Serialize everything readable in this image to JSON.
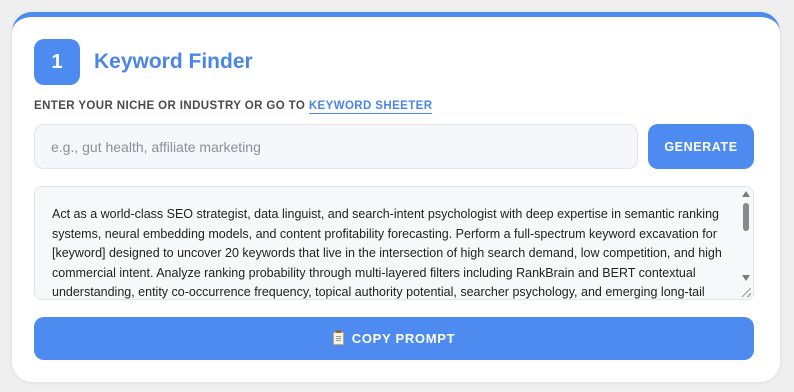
{
  "step": {
    "number": "1",
    "title": "Keyword Finder"
  },
  "instruction": {
    "text": "ENTER YOUR NICHE OR INDUSTRY OR GO TO ",
    "link_label": "KEYWORD SHEETER"
  },
  "niche_input": {
    "value": "",
    "placeholder": "e.g., gut health, affiliate marketing"
  },
  "generate_button": {
    "label": "GENERATE"
  },
  "prompt": {
    "text": "Act as a world-class SEO strategist, data linguist, and search-intent psychologist with deep expertise in semantic ranking systems, neural embedding models, and content profitability forecasting. Perform a full-spectrum keyword excavation for [keyword] designed to uncover 20 keywords that live in the intersection of high search demand, low competition, and high commercial intent. Analyze ranking probability through multi-layered filters including RankBrain and BERT contextual understanding, entity co-occurrence frequency, topical authority potential, searcher psychology, and emerging long-tail"
  },
  "copy_button": {
    "label": "COPY PROMPT",
    "icon": "clipboard-icon"
  },
  "colors": {
    "accent": "#4d8bf0",
    "title": "#4a86e8",
    "background": "#efefef",
    "card": "#ffffff",
    "input_bg": "#f5f7fa"
  }
}
